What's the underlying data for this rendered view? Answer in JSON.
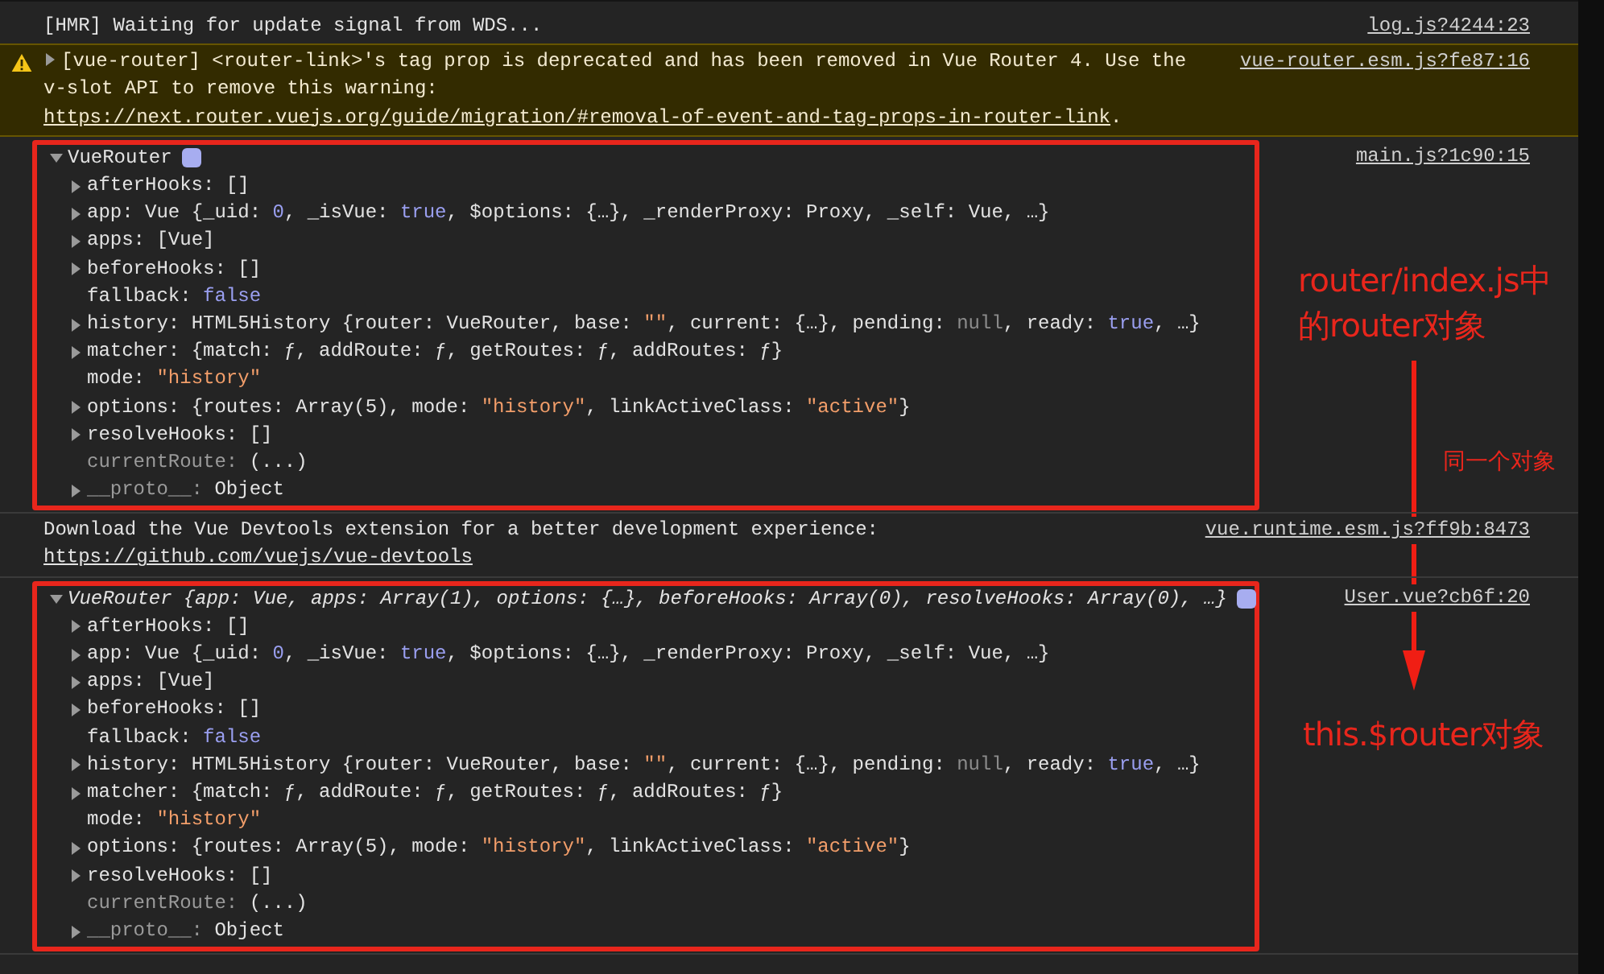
{
  "console": {
    "messages": [
      {
        "kind": "log",
        "text": "[HMR] Waiting for update signal from WDS...",
        "source": "log.js?4244:23"
      },
      {
        "kind": "warning",
        "expanded": false,
        "text": "[vue-router] <router-link>'s tag prop is deprecated and has been removed in Vue Router 4. Use the v-slot API to remove this warning: ",
        "link": "https://next.router.vuejs.org/guide/migration/#removal-of-event-and-tag-props-in-router-link",
        "text_after": ".",
        "source": "vue-router.esm.js?fe87:16"
      },
      {
        "kind": "object",
        "expanded": true,
        "title": "VueRouter",
        "source": "main.js?1c90:15",
        "properties": [
          {
            "name": "afterHooks:",
            "expandable": true,
            "dim": false,
            "value": [
              {
                "kind": "plain",
                "text": "[]"
              }
            ]
          },
          {
            "name": "app:",
            "expandable": true,
            "dim": false,
            "value": [
              {
                "kind": "plain",
                "text": "Vue {_uid: "
              },
              {
                "kind": "number",
                "text": "0"
              },
              {
                "kind": "plain",
                "text": ", _isVue: "
              },
              {
                "kind": "bool",
                "text": "true"
              },
              {
                "kind": "plain",
                "text": ", $options: {…}, _renderProxy: Proxy, _self: Vue, …}"
              }
            ]
          },
          {
            "name": "apps:",
            "expandable": true,
            "dim": false,
            "value": [
              {
                "kind": "plain",
                "text": "[Vue]"
              }
            ]
          },
          {
            "name": "beforeHooks:",
            "expandable": true,
            "dim": false,
            "value": [
              {
                "kind": "plain",
                "text": "[]"
              }
            ]
          },
          {
            "name": "fallback:",
            "expandable": false,
            "dim": false,
            "value": [
              {
                "kind": "bool",
                "text": "false"
              }
            ]
          },
          {
            "name": "history:",
            "expandable": true,
            "dim": false,
            "value": [
              {
                "kind": "plain",
                "text": "HTML5History {router: VueRouter, base: "
              },
              {
                "kind": "string",
                "text": "\"\""
              },
              {
                "kind": "plain",
                "text": ", current: {…}, pending: "
              },
              {
                "kind": "null",
                "text": "null"
              },
              {
                "kind": "plain",
                "text": ", ready: "
              },
              {
                "kind": "bool",
                "text": "true"
              },
              {
                "kind": "plain",
                "text": ", …}"
              }
            ]
          },
          {
            "name": "matcher:",
            "expandable": true,
            "dim": false,
            "value": [
              {
                "kind": "plain",
                "text": "{match: ƒ, addRoute: ƒ, getRoutes: ƒ, addRoutes: ƒ}"
              }
            ]
          },
          {
            "name": "mode:",
            "expandable": false,
            "dim": false,
            "value": [
              {
                "kind": "string",
                "text": "\"history\""
              }
            ]
          },
          {
            "name": "options:",
            "expandable": true,
            "dim": false,
            "value": [
              {
                "kind": "plain",
                "text": "{routes: Array(5), mode: "
              },
              {
                "kind": "string",
                "text": "\"history\""
              },
              {
                "kind": "plain",
                "text": ", linkActiveClass: "
              },
              {
                "kind": "string",
                "text": "\"active\""
              },
              {
                "kind": "plain",
                "text": "}"
              }
            ]
          },
          {
            "name": "resolveHooks:",
            "expandable": true,
            "dim": false,
            "value": [
              {
                "kind": "plain",
                "text": "[]"
              }
            ]
          },
          {
            "name": "currentRoute:",
            "expandable": false,
            "dim": true,
            "value": [
              {
                "kind": "plain",
                "text": "(...)"
              }
            ]
          },
          {
            "name": "__proto__:",
            "expandable": true,
            "dim": true,
            "value": [
              {
                "kind": "plain",
                "text": "Object"
              }
            ]
          }
        ]
      },
      {
        "kind": "log",
        "text": "Download the Vue Devtools extension for a better development experience:",
        "link": "https://github.com/vuejs/vue-devtools",
        "source": "vue.runtime.esm.js?ff9b:8473"
      },
      {
        "kind": "object",
        "expanded": true,
        "title": "VueRouter",
        "preview": "{app: Vue, apps: Array(1), options: {…}, beforeHooks: Array(0), resolveHooks: Array(0), …}",
        "source": "User.vue?cb6f:20",
        "properties": [
          {
            "name": "afterHooks:",
            "expandable": true,
            "dim": false,
            "value": [
              {
                "kind": "plain",
                "text": "[]"
              }
            ]
          },
          {
            "name": "app:",
            "expandable": true,
            "dim": false,
            "value": [
              {
                "kind": "plain",
                "text": "Vue {_uid: "
              },
              {
                "kind": "number",
                "text": "0"
              },
              {
                "kind": "plain",
                "text": ", _isVue: "
              },
              {
                "kind": "bool",
                "text": "true"
              },
              {
                "kind": "plain",
                "text": ", $options: {…}, _renderProxy: Proxy, _self: Vue, …}"
              }
            ]
          },
          {
            "name": "apps:",
            "expandable": true,
            "dim": false,
            "value": [
              {
                "kind": "plain",
                "text": "[Vue]"
              }
            ]
          },
          {
            "name": "beforeHooks:",
            "expandable": true,
            "dim": false,
            "value": [
              {
                "kind": "plain",
                "text": "[]"
              }
            ]
          },
          {
            "name": "fallback:",
            "expandable": false,
            "dim": false,
            "value": [
              {
                "kind": "bool",
                "text": "false"
              }
            ]
          },
          {
            "name": "history:",
            "expandable": true,
            "dim": false,
            "value": [
              {
                "kind": "plain",
                "text": "HTML5History {router: VueRouter, base: "
              },
              {
                "kind": "string",
                "text": "\"\""
              },
              {
                "kind": "plain",
                "text": ", current: {…}, pending: "
              },
              {
                "kind": "null",
                "text": "null"
              },
              {
                "kind": "plain",
                "text": ", ready: "
              },
              {
                "kind": "bool",
                "text": "true"
              },
              {
                "kind": "plain",
                "text": ", …}"
              }
            ]
          },
          {
            "name": "matcher:",
            "expandable": true,
            "dim": false,
            "value": [
              {
                "kind": "plain",
                "text": "{match: ƒ, addRoute: ƒ, getRoutes: ƒ, addRoutes: ƒ}"
              }
            ]
          },
          {
            "name": "mode:",
            "expandable": false,
            "dim": false,
            "value": [
              {
                "kind": "string",
                "text": "\"history\""
              }
            ]
          },
          {
            "name": "options:",
            "expandable": true,
            "dim": false,
            "value": [
              {
                "kind": "plain",
                "text": "{routes: Array(5), mode: "
              },
              {
                "kind": "string",
                "text": "\"history\""
              },
              {
                "kind": "plain",
                "text": ", linkActiveClass: "
              },
              {
                "kind": "string",
                "text": "\"active\""
              },
              {
                "kind": "plain",
                "text": "}"
              }
            ]
          },
          {
            "name": "resolveHooks:",
            "expandable": true,
            "dim": false,
            "value": [
              {
                "kind": "plain",
                "text": "[]"
              }
            ]
          },
          {
            "name": "currentRoute:",
            "expandable": false,
            "dim": true,
            "value": [
              {
                "kind": "plain",
                "text": "(...)"
              }
            ]
          },
          {
            "name": "__proto__:",
            "expandable": true,
            "dim": true,
            "value": [
              {
                "kind": "plain",
                "text": "Object"
              }
            ]
          }
        ]
      }
    ]
  },
  "annotations": [
    {
      "kind": "label",
      "text": "router/index.js中的router对象"
    },
    {
      "kind": "arrow"
    },
    {
      "kind": "note",
      "text": "同一个对象"
    },
    {
      "kind": "label",
      "text": "this.$router对象"
    }
  ]
}
